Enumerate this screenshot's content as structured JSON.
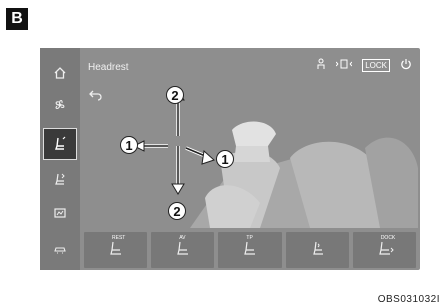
{
  "badge": "B",
  "screen": {
    "title": "Headrest",
    "status": {
      "lock_label": "LOCK"
    },
    "sidebar": {
      "items": [
        {
          "icon": "home-icon"
        },
        {
          "icon": "fan-icon"
        },
        {
          "icon": "seat-icon",
          "active": true
        },
        {
          "icon": "seat-adjust-icon"
        },
        {
          "icon": "display-icon"
        },
        {
          "icon": "car-icon"
        }
      ]
    },
    "callouts": [
      "2",
      "1",
      "1",
      "2"
    ],
    "bottom_buttons": [
      {
        "label": "REST"
      },
      {
        "label": "AV"
      },
      {
        "label": "TP"
      },
      {
        "label": ""
      },
      {
        "label": "DOCK"
      }
    ]
  },
  "image_code": "OBS031032I"
}
